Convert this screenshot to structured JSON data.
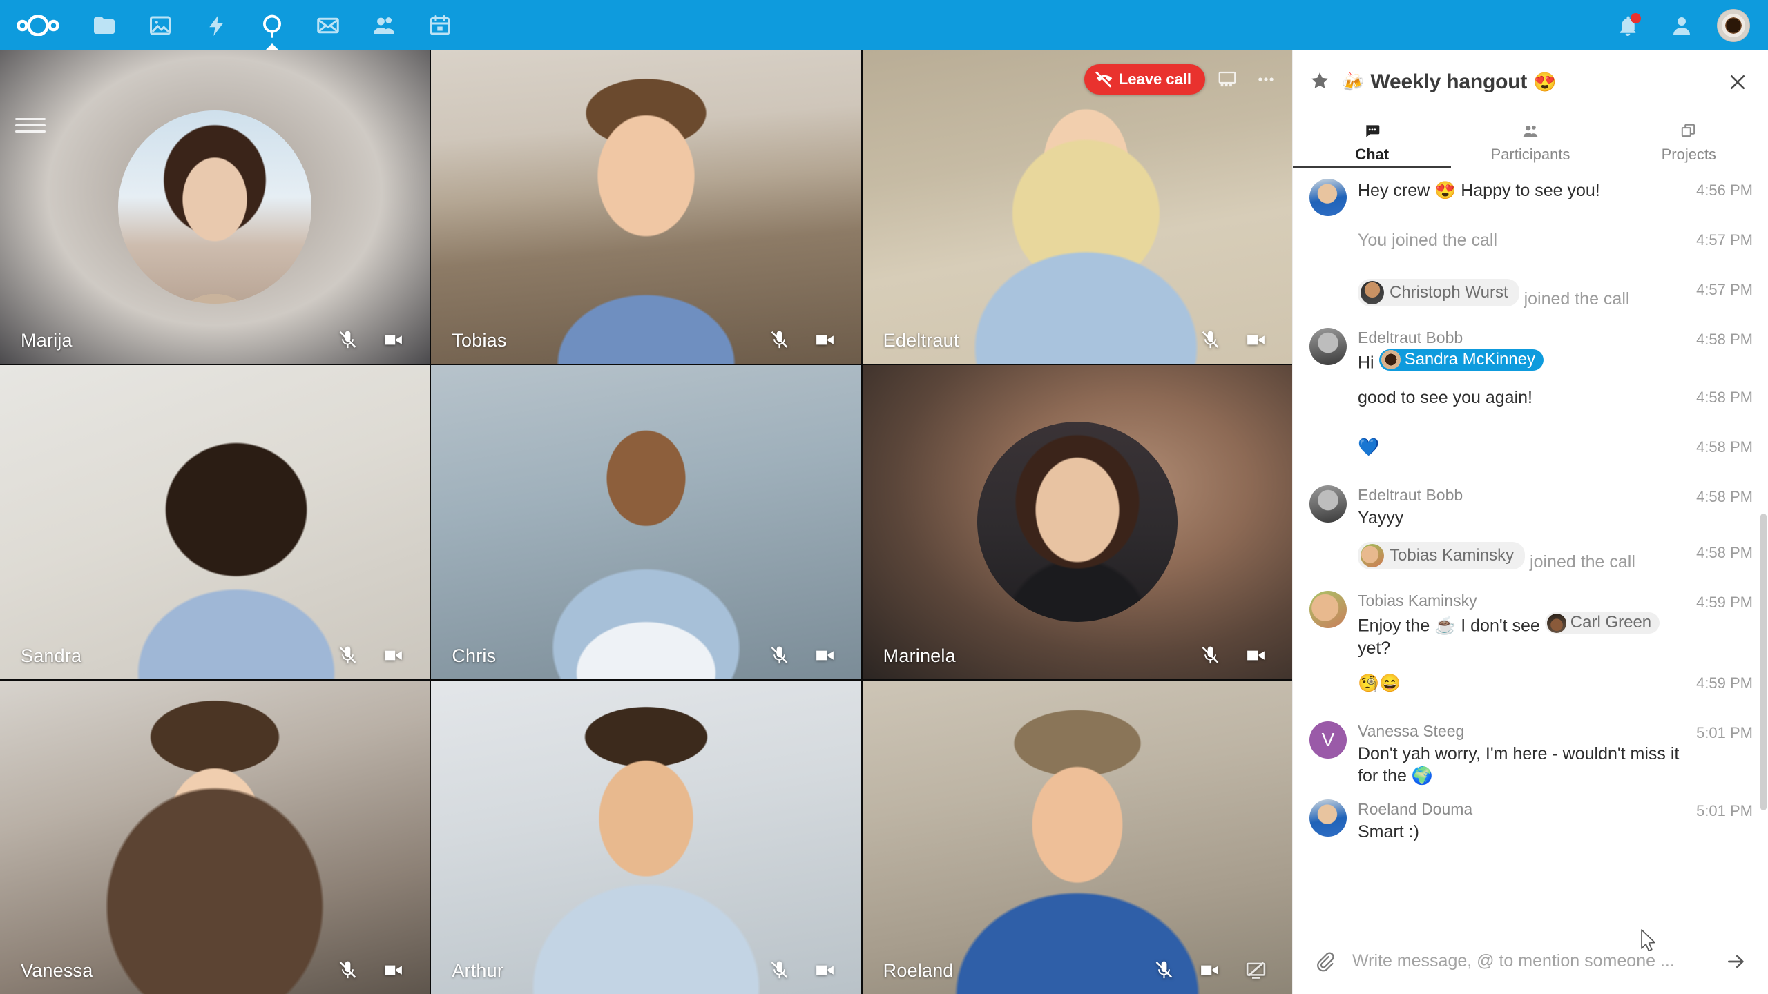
{
  "app": {
    "brand": "Nextcloud",
    "accent_color": "#0e9bdd",
    "danger_color": "#e9322e"
  },
  "topnav": {
    "logo_name": "nextcloud-logo",
    "items": [
      {
        "name": "files",
        "icon": "folder-icon",
        "active": false
      },
      {
        "name": "photos",
        "icon": "photos-icon",
        "active": false
      },
      {
        "name": "activity",
        "icon": "activity-bolt-icon",
        "active": false
      },
      {
        "name": "talk",
        "icon": "talk-icon",
        "active": true
      },
      {
        "name": "mail",
        "icon": "mail-icon",
        "active": false
      },
      {
        "name": "contacts",
        "icon": "contacts-icon",
        "active": false
      },
      {
        "name": "calendar",
        "icon": "calendar-icon",
        "active": false
      }
    ],
    "right": [
      {
        "name": "notifications",
        "icon": "bell-icon",
        "badge": true
      },
      {
        "name": "contacts-menu",
        "icon": "contacts-menu-icon",
        "badge": false
      }
    ],
    "avatar_name": "user-avatar"
  },
  "call": {
    "leave_label": "Leave call",
    "leave_icon": "call-end-icon",
    "grid_view_icon": "presentation-icon",
    "more_icon": "more-options-icon",
    "menu_icon": "hamburger-menu-icon",
    "participants": [
      {
        "name": "Marija",
        "video": false,
        "audio_muted": true,
        "screenshare": false
      },
      {
        "name": "Tobias",
        "video": true,
        "audio_muted": true,
        "screenshare": false
      },
      {
        "name": "Edeltraut",
        "video": true,
        "audio_muted": true,
        "screenshare": false
      },
      {
        "name": "Sandra",
        "video": true,
        "audio_muted": true,
        "screenshare": false
      },
      {
        "name": "Chris",
        "video": true,
        "audio_muted": true,
        "screenshare": false
      },
      {
        "name": "Marinela",
        "video": false,
        "audio_muted": true,
        "screenshare": false
      },
      {
        "name": "Vanessa",
        "video": true,
        "audio_muted": true,
        "screenshare": false
      },
      {
        "name": "Arthur",
        "video": true,
        "audio_muted": true,
        "screenshare": false
      },
      {
        "name": "Roeland",
        "video": true,
        "audio_muted": true,
        "screenshare": true
      }
    ]
  },
  "sidebar": {
    "star_icon": "favorite-star-icon",
    "title_emoji": "🍻",
    "title": "Weekly hangout",
    "title_emoji_end": "😍",
    "close_icon": "close-icon",
    "tabs": [
      {
        "label": "Chat",
        "icon": "chat-bubble-icon",
        "active": true
      },
      {
        "label": "Participants",
        "icon": "participants-icon",
        "active": false
      },
      {
        "label": "Projects",
        "icon": "projects-icon",
        "active": false
      }
    ],
    "messages": [
      {
        "kind": "message",
        "author": "",
        "avatar": "roeland",
        "text": "Hey crew 😍 Happy to see you!",
        "time": "4:56 PM"
      },
      {
        "kind": "system",
        "author": "",
        "avatar": "none",
        "text": "You joined the call",
        "time": "4:57 PM"
      },
      {
        "kind": "join",
        "author": "",
        "avatar": "none",
        "pill": "Christoph Wurst",
        "pill_avatar": "christoph",
        "text": "joined the call",
        "time": "4:57 PM"
      },
      {
        "kind": "message",
        "author": "Edeltraut Bobb",
        "avatar": "edeltraut",
        "text_pre": "Hi ",
        "mention": "Sandra McKinney",
        "mention_avatar": "sandra",
        "text_post": "",
        "time": "4:58 PM"
      },
      {
        "kind": "message",
        "author": "",
        "avatar": "none",
        "text": "good to see you again!",
        "time": "4:58 PM"
      },
      {
        "kind": "emoji",
        "author": "",
        "avatar": "none",
        "text": "💙",
        "time": "4:58 PM"
      },
      {
        "kind": "message",
        "author": "Edeltraut Bobb",
        "avatar": "edeltraut",
        "text": "Yayyy",
        "time": "4:58 PM"
      },
      {
        "kind": "join",
        "author": "",
        "avatar": "none",
        "pill": "Tobias Kaminsky",
        "pill_avatar": "tobias",
        "text": "joined the call",
        "time": "4:58 PM"
      },
      {
        "kind": "message",
        "author": "Tobias Kaminsky",
        "avatar": "tobias",
        "text_pre": "Enjoy the ☕ I don't see ",
        "mention": "Carl Green",
        "mention_avatar": "carl",
        "mention_grey": true,
        "text_post": " yet?",
        "time": "4:59 PM"
      },
      {
        "kind": "emoji",
        "author": "",
        "avatar": "none",
        "text": "🧐😄",
        "time": "4:59 PM"
      },
      {
        "kind": "message",
        "author": "Vanessa Steeg",
        "avatar": "vanessa-initial",
        "text": "Don't yah worry, I'm here - wouldn't miss it for the 🌍",
        "time": "5:01 PM"
      },
      {
        "kind": "message",
        "author": "Roeland Douma",
        "avatar": "roeland",
        "text": "Smart :)",
        "time": "5:01 PM"
      }
    ],
    "composer": {
      "attach_icon": "attachment-paperclip-icon",
      "placeholder": "Write message, @ to mention someone ...",
      "value": "",
      "send_icon": "send-arrow-icon"
    }
  }
}
